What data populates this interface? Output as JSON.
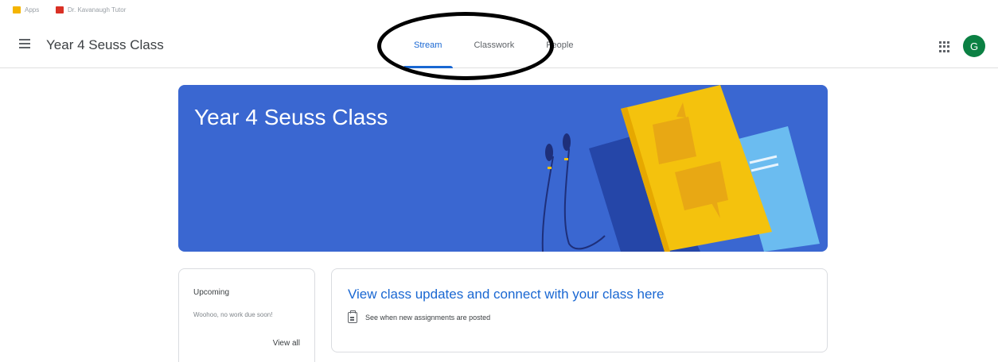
{
  "bookmarks": [
    {
      "label": "Apps",
      "icon": "apps-bookmark-icon"
    },
    {
      "label": "Dr. Kavanaugh Tutor",
      "icon": "bookmark-icon"
    }
  ],
  "appbar": {
    "class_title": "Year 4 Seuss Class",
    "tabs": [
      {
        "label": "Stream",
        "active": true
      },
      {
        "label": "Classwork",
        "active": false
      },
      {
        "label": "People",
        "active": false
      }
    ],
    "avatar_initial": "G",
    "accent": "#1967d2"
  },
  "banner": {
    "title": "Year 4 Seuss Class",
    "color": "#3a67d1"
  },
  "upcoming": {
    "title": "Upcoming",
    "subtitle": "Woohoo, no work due soon!",
    "link": "View all"
  },
  "stream": {
    "headline": "View class updates and connect with your class here",
    "info": "See when new assignments are posted"
  }
}
